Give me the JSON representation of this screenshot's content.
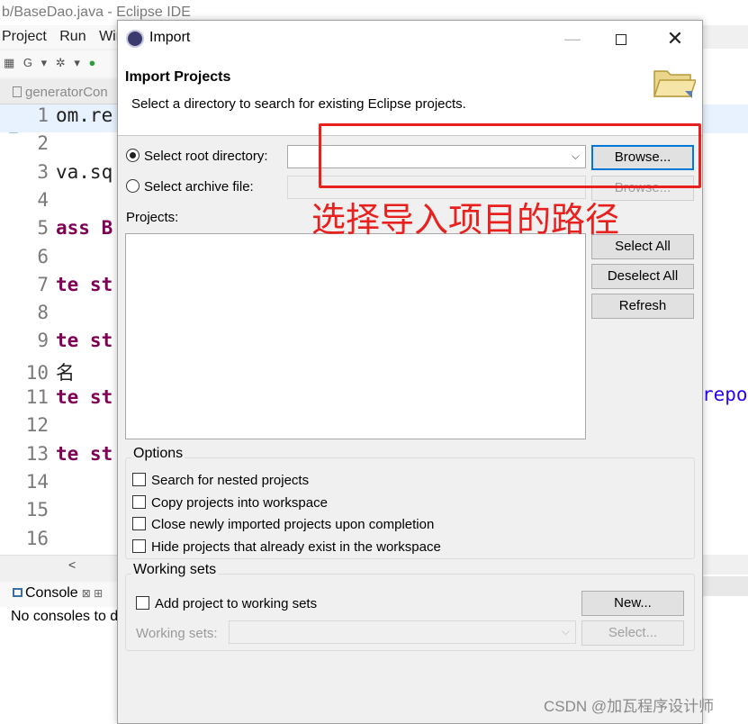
{
  "ide": {
    "window_title": "b/BaseDao.java - Eclipse IDE",
    "menu": [
      "Project",
      "Run",
      "Win"
    ],
    "toolbar_glyphs": [
      "▦",
      "G",
      "▾",
      "✲",
      "▾",
      "●"
    ],
    "editor_tab": "generatorCon",
    "lines": [
      {
        "num": "1",
        "code": "om.re"
      },
      {
        "num": "2",
        "code": ""
      },
      {
        "num": "3",
        "code": "va.sq"
      },
      {
        "num": "4",
        "code": ""
      },
      {
        "num": "5",
        "code": "ass B"
      },
      {
        "num": "6",
        "code": ""
      },
      {
        "num": "7",
        "code": "te st"
      },
      {
        "num": "8",
        "code": ""
      },
      {
        "num": "9",
        "code": "te st"
      },
      {
        "num": "10",
        "code": "名"
      },
      {
        "num": "11",
        "code": "te st"
      },
      {
        "num": "12",
        "code": ""
      },
      {
        "num": "13",
        "code": "te st"
      },
      {
        "num": "14",
        "code": ""
      },
      {
        "num": "15",
        "code": ""
      },
      {
        "num": "16",
        "code": ""
      }
    ],
    "right_code_fragment": "repor",
    "scroll_left_glyph": "<",
    "console_tab": "Console",
    "console_tab_glyph": "⊠ ⊞",
    "console_text": "No consoles to d"
  },
  "dialog": {
    "title": "Import",
    "window_buttons": {
      "minimize": "—",
      "close": "✕"
    },
    "header_title": "Import Projects",
    "header_desc": "Select a directory to search for existing Eclipse projects.",
    "root_dir": {
      "label": "Select root directory:",
      "value": "",
      "selected": true
    },
    "archive": {
      "label": "Select archive file:",
      "value": "",
      "selected": false
    },
    "browse_label": "Browse...",
    "browse_disabled_label": "Browse...",
    "projects_label": "Projects:",
    "select_all": "Select All",
    "deselect_all": "Deselect All",
    "refresh": "Refresh",
    "options": {
      "title": "Options",
      "items": [
        "Search for nested projects",
        "Copy projects into workspace",
        "Close newly imported projects upon completion",
        "Hide projects that already exist in the workspace"
      ]
    },
    "working_sets": {
      "title": "Working sets",
      "add_label": "Add project to working sets",
      "new_button": "New...",
      "sets_label": "Working sets:",
      "select_button": "Select..."
    },
    "combo_arrow": "⌵"
  },
  "annotation": {
    "text": "选择导入项目的路径",
    "color": "#e8201e"
  },
  "watermark": "CSDN @加瓦程序设计师",
  "colors": {
    "accent": "#0078d7",
    "keyword": "#7f0055",
    "string": "#2a00ff"
  }
}
